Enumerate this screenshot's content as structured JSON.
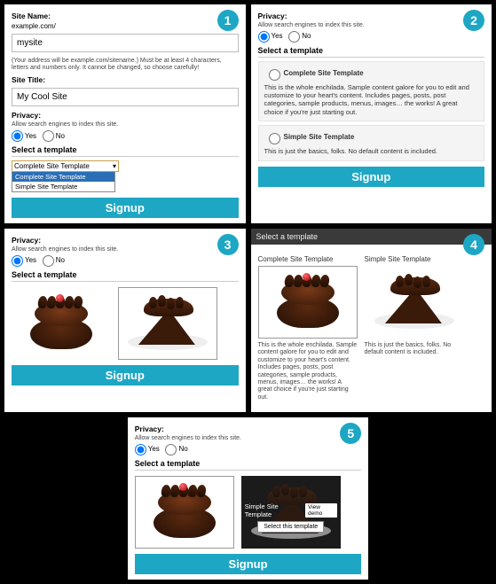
{
  "badges": [
    "1",
    "2",
    "3",
    "4",
    "5"
  ],
  "form": {
    "site_name_label": "Site Name:",
    "url_prefix": "example.com/",
    "site_name_value": "mysite",
    "address_help": "(Your address will be example.com/sitename.) Must be at least 4 characters, letters and numbers only. It cannot be changed, so choose carefully!",
    "site_title_label": "Site Title:",
    "site_title_value": "My Cool Site",
    "privacy_label": "Privacy:",
    "privacy_help": "Allow search engines to index this site.",
    "yes": "Yes",
    "no": "No",
    "select_template": "Select a template",
    "signup": "Signup"
  },
  "select": {
    "current": "Complete Site Template",
    "opts": [
      "Complete Site Template",
      "Simple Site Template"
    ]
  },
  "templates": {
    "complete": {
      "title": "Complete Site Template",
      "desc_long": "This is the whole enchilada. Sample content galore for you to edit and customize to your heart's content. Includes pages, posts, post categories, sample products, menus, images… the works! A great choice if you're just starting out.",
      "desc_short": "This is the whole enchilada. Sample content galore for you to edit and customize to your heart's content. Includes pages, posts, post categories, sample products, menus, images… the works! A great choice if you're just starting out."
    },
    "simple": {
      "title": "Simple Site Template",
      "desc_long": "This is just the basics, folks. No default content is included.",
      "desc_short": "This is just the basics, folks. No default content is included."
    }
  },
  "overlay": {
    "name": "Simple Site Template",
    "view_demo": "View demo",
    "select_btn": "Select this template"
  }
}
